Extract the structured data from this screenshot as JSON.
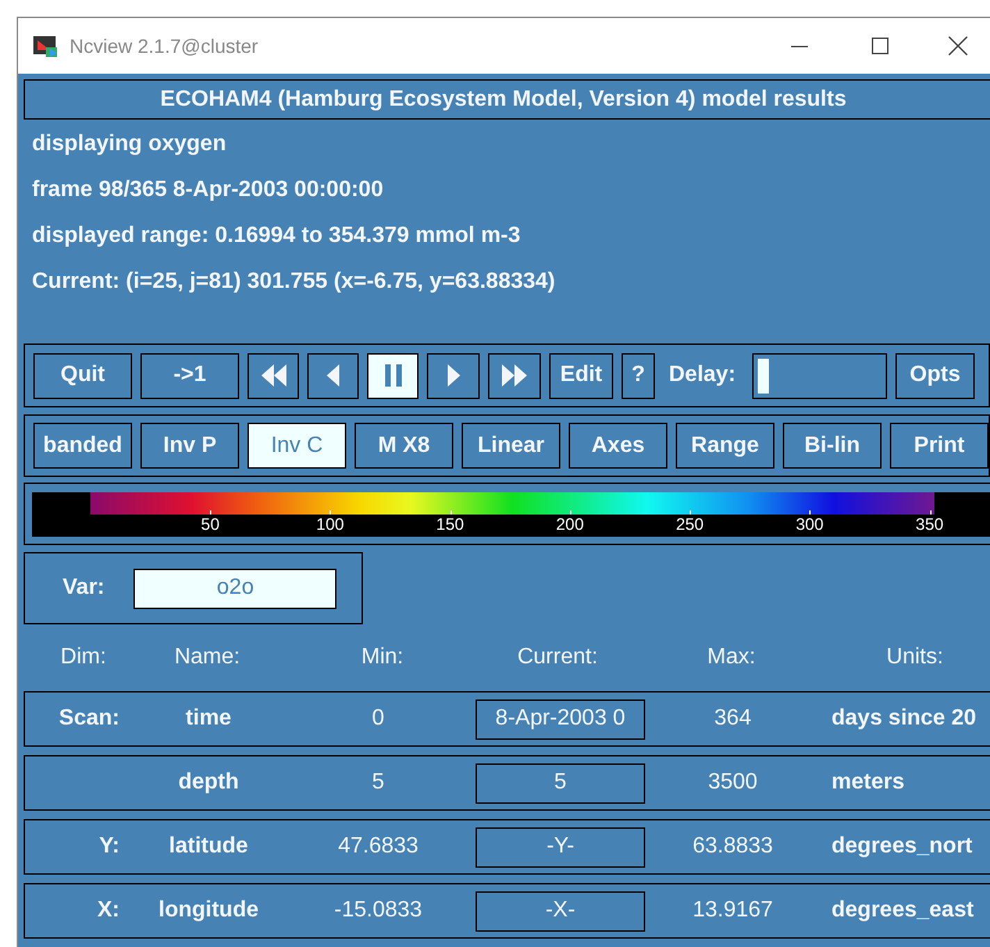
{
  "window": {
    "title": "Ncview 2.1.7@cluster"
  },
  "header": "ECOHAM4 (Hamburg Ecosystem Model, Version 4) model results",
  "info_lines": [
    "displaying oxygen",
    "frame 98/365 8-Apr-2003 00:00:00",
    "displayed range: 0.16994 to 354.379 mmol m-3",
    "Current: (i=25, j=81) 301.755 (x=-6.75, y=63.88334)"
  ],
  "toolbar": [
    {
      "kind": "text",
      "label": "Quit",
      "selected": false
    },
    {
      "kind": "text",
      "label": "->1",
      "selected": false
    },
    {
      "kind": "rewind",
      "selected": false
    },
    {
      "kind": "back",
      "selected": false
    },
    {
      "kind": "pause",
      "selected": true
    },
    {
      "kind": "forward",
      "selected": false
    },
    {
      "kind": "fast_forward",
      "selected": false
    },
    {
      "kind": "text",
      "label": "Edit",
      "selected": false
    },
    {
      "kind": "text",
      "label": "?",
      "selected": false
    }
  ],
  "delay": {
    "label": "Delay:",
    "level": 0
  },
  "options_button": "Opts",
  "display_buttons": [
    {
      "label": "banded",
      "selected": false
    },
    {
      "label": "Inv P",
      "selected": false
    },
    {
      "label": "Inv C",
      "selected": true
    },
    {
      "label": "M X8",
      "selected": false
    },
    {
      "label": "Linear",
      "selected": false
    },
    {
      "label": "Axes",
      "selected": false
    },
    {
      "label": "Range",
      "selected": false
    },
    {
      "label": "Bi-lin",
      "selected": false
    },
    {
      "label": "Print",
      "selected": false
    }
  ],
  "colorbar": {
    "tick_labels": [
      "50",
      "100",
      "150",
      "200",
      "250",
      "300",
      "350"
    ]
  },
  "var": {
    "label": "Var:",
    "value": "o2o"
  },
  "dims": {
    "columns": [
      "Dim:",
      "Name:",
      "Min:",
      "Current:",
      "Max:",
      "Units:"
    ],
    "rows": [
      {
        "dim": "Scan:",
        "name": "time",
        "min": "0",
        "current": "8-Apr-2003 0",
        "max": "364",
        "units": "days since 20"
      },
      {
        "name": "depth",
        "min": "5",
        "current": "5",
        "max": "3500",
        "units": "meters"
      },
      {
        "dim": "Y:",
        "name": "latitude",
        "min": "47.6833",
        "current": "-Y-",
        "max": "63.8833",
        "units": "degrees_nort"
      },
      {
        "dim": "X:",
        "name": "longitude",
        "min": "-15.0833",
        "current": "-X-",
        "max": "13.9167",
        "units": "degrees_east"
      }
    ]
  }
}
